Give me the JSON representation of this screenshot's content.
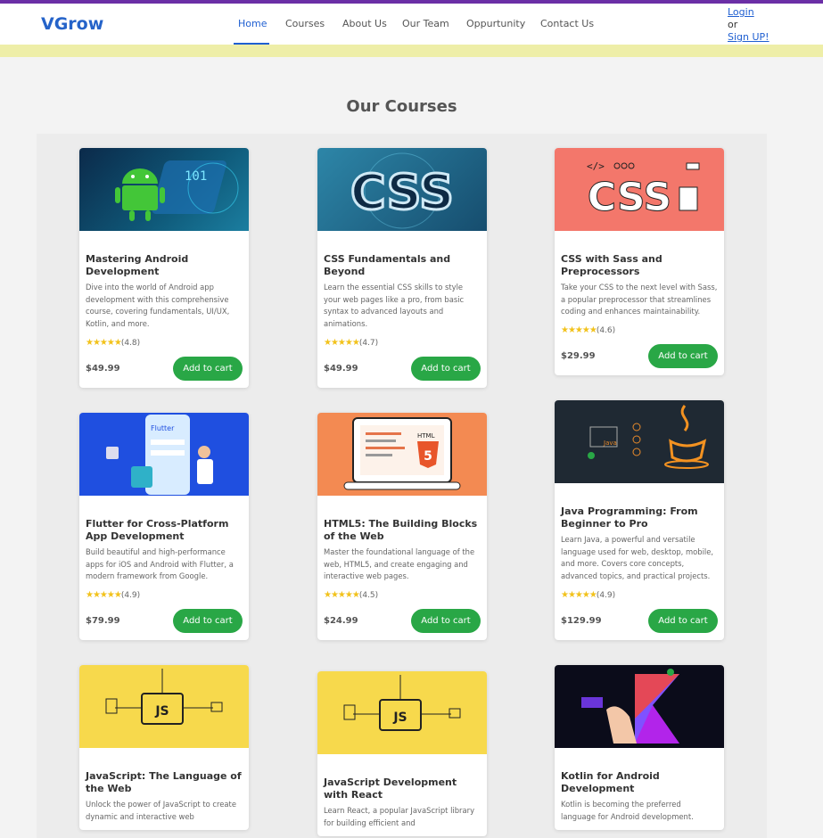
{
  "brand": "VGrow",
  "nav": {
    "home": "Home",
    "courses": "Courses",
    "about": "About Us",
    "team": "Our Team",
    "opportunity": "Oppurtunity",
    "contact": "Contact Us"
  },
  "auth": {
    "login": "Login",
    "or": "or",
    "signup": "Sign UP!"
  },
  "page_title": "Our Courses",
  "cards": [
    {
      "title": "Mastering Android Development",
      "desc": "Dive into the world of Android app development with this comprehensive course, covering fundamentals, UI/UX, Kotlin, and more.",
      "stars": "★★★★★",
      "rating": "(4.8)",
      "price": "$49.99",
      "button": "Add to cart"
    },
    {
      "title": "CSS Fundamentals and Beyond",
      "desc": "Learn the essential CSS skills to style your web pages like a pro, from basic syntax to advanced layouts and animations.",
      "stars": "★★★★★",
      "rating": "(4.7)",
      "price": "$49.99",
      "button": "Add to cart"
    },
    {
      "title": "CSS with Sass and Preprocessors",
      "desc": "Take your CSS to the next level with Sass, a popular preprocessor that streamlines coding and enhances maintainability.",
      "stars": "★★★★★",
      "rating": "(4.6)",
      "price": "$29.99",
      "button": "Add to cart"
    },
    {
      "title": "Flutter for Cross-Platform App Development",
      "desc": "Build beautiful and high-performance apps for iOS and Android with Flutter, a modern framework from Google.",
      "stars": "★★★★★",
      "rating": "(4.9)",
      "price": "$79.99",
      "button": "Add to cart"
    },
    {
      "title": "HTML5: The Building Blocks of the Web",
      "desc": "Master the foundational language of the web, HTML5, and create engaging and interactive web pages.",
      "stars": "★★★★★",
      "rating": "(4.5)",
      "price": "$24.99",
      "button": "Add to cart"
    },
    {
      "title": "Java Programming: From Beginner to Pro",
      "desc": "Learn Java, a powerful and versatile language used for web, desktop, mobile, and more. Covers core concepts, advanced topics, and practical projects.",
      "stars": "★★★★★",
      "rating": "(4.9)",
      "price": "$129.99",
      "button": "Add to cart"
    },
    {
      "title": "JavaScript: The Language of the Web",
      "desc": "Unlock the power of JavaScript to create dynamic and interactive web",
      "stars": "",
      "rating": "",
      "price": "",
      "button": ""
    },
    {
      "title": "JavaScript Development with React",
      "desc": "Learn React, a popular JavaScript library for building efficient and",
      "stars": "",
      "rating": "",
      "price": "",
      "button": ""
    },
    {
      "title": "Kotlin for Android Development",
      "desc": "Kotlin is becoming the preferred language for Android development.",
      "stars": "",
      "rating": "",
      "price": "",
      "button": ""
    }
  ],
  "image_labels": {
    "css": "CSS",
    "html": "HTML",
    "html_num": "5",
    "js": "JS",
    "flutter": "Flutter",
    "java": "Java",
    "binary": "101"
  },
  "colors": {
    "accent": "#1f5fd1",
    "button": "#29a746",
    "star": "#f2c21b",
    "topline": "#6b2fa6"
  }
}
